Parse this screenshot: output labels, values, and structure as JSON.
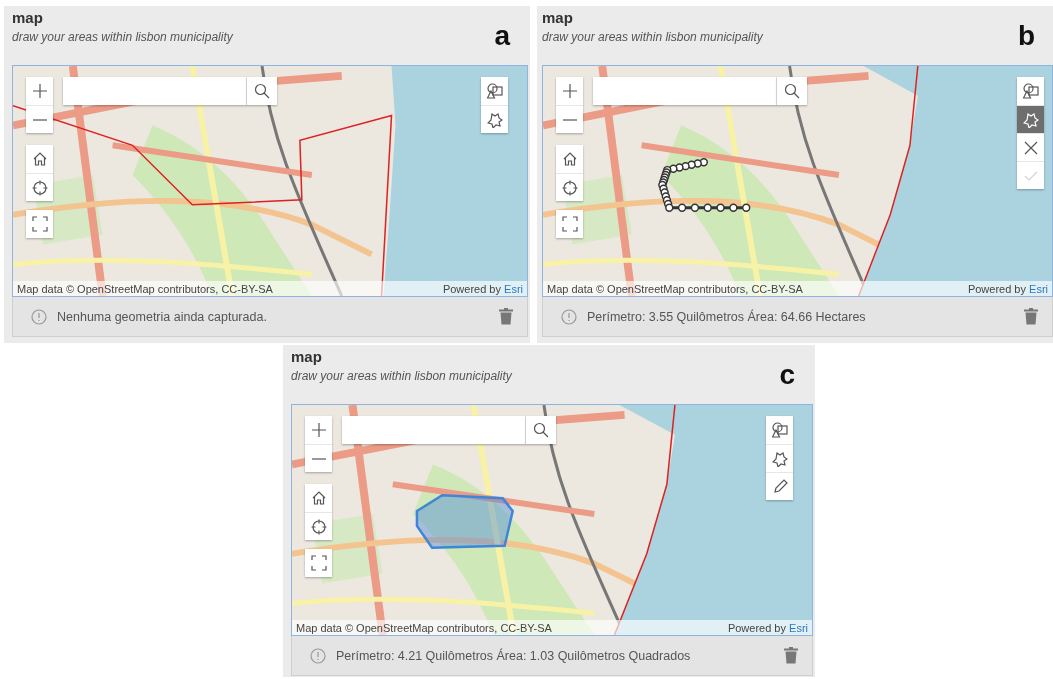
{
  "panels": [
    {
      "label": "a",
      "title": "map",
      "subtitle": "draw your areas within lisbon municipality",
      "tools": [
        {
          "kind": "shapes",
          "selected": false,
          "disabled": false
        },
        {
          "kind": "polygon",
          "selected": false,
          "disabled": false
        }
      ],
      "attribution": "Map data © OpenStreetMap contributors, CC-BY-SA",
      "powered_by": "Powered by",
      "powered_link": "Esri",
      "status": "Nenhuma geometria ainda capturada."
    },
    {
      "label": "b",
      "title": "map",
      "subtitle": "draw your areas within lisbon municipality",
      "tools": [
        {
          "kind": "shapes",
          "selected": false,
          "disabled": false
        },
        {
          "kind": "polygon",
          "selected": true,
          "disabled": false
        },
        {
          "kind": "cancel",
          "selected": false,
          "disabled": false
        },
        {
          "kind": "done",
          "selected": false,
          "disabled": true
        }
      ],
      "sketch_in_progress": true,
      "attribution": "Map data © OpenStreetMap contributors, CC-BY-SA",
      "powered_by": "Powered by",
      "powered_link": "Esri",
      "status": "Perímetro: 3.55 Quilômetros Área: 64.66 Hectares"
    },
    {
      "label": "c",
      "title": "map",
      "subtitle": "draw your areas within lisbon municipality",
      "tools": [
        {
          "kind": "shapes",
          "selected": false,
          "disabled": false
        },
        {
          "kind": "polygon",
          "selected": false,
          "disabled": false
        },
        {
          "kind": "edit",
          "selected": false,
          "disabled": false
        }
      ],
      "area_drawn": true,
      "attribution": "Map data © OpenStreetMap contributors, CC-BY-SA",
      "powered_by": "Powered by",
      "powered_link": "Esri",
      "status": "Perímetro: 4.21 Quilômetros Área: 1.03 Quilômetros Quadrados"
    }
  ]
}
